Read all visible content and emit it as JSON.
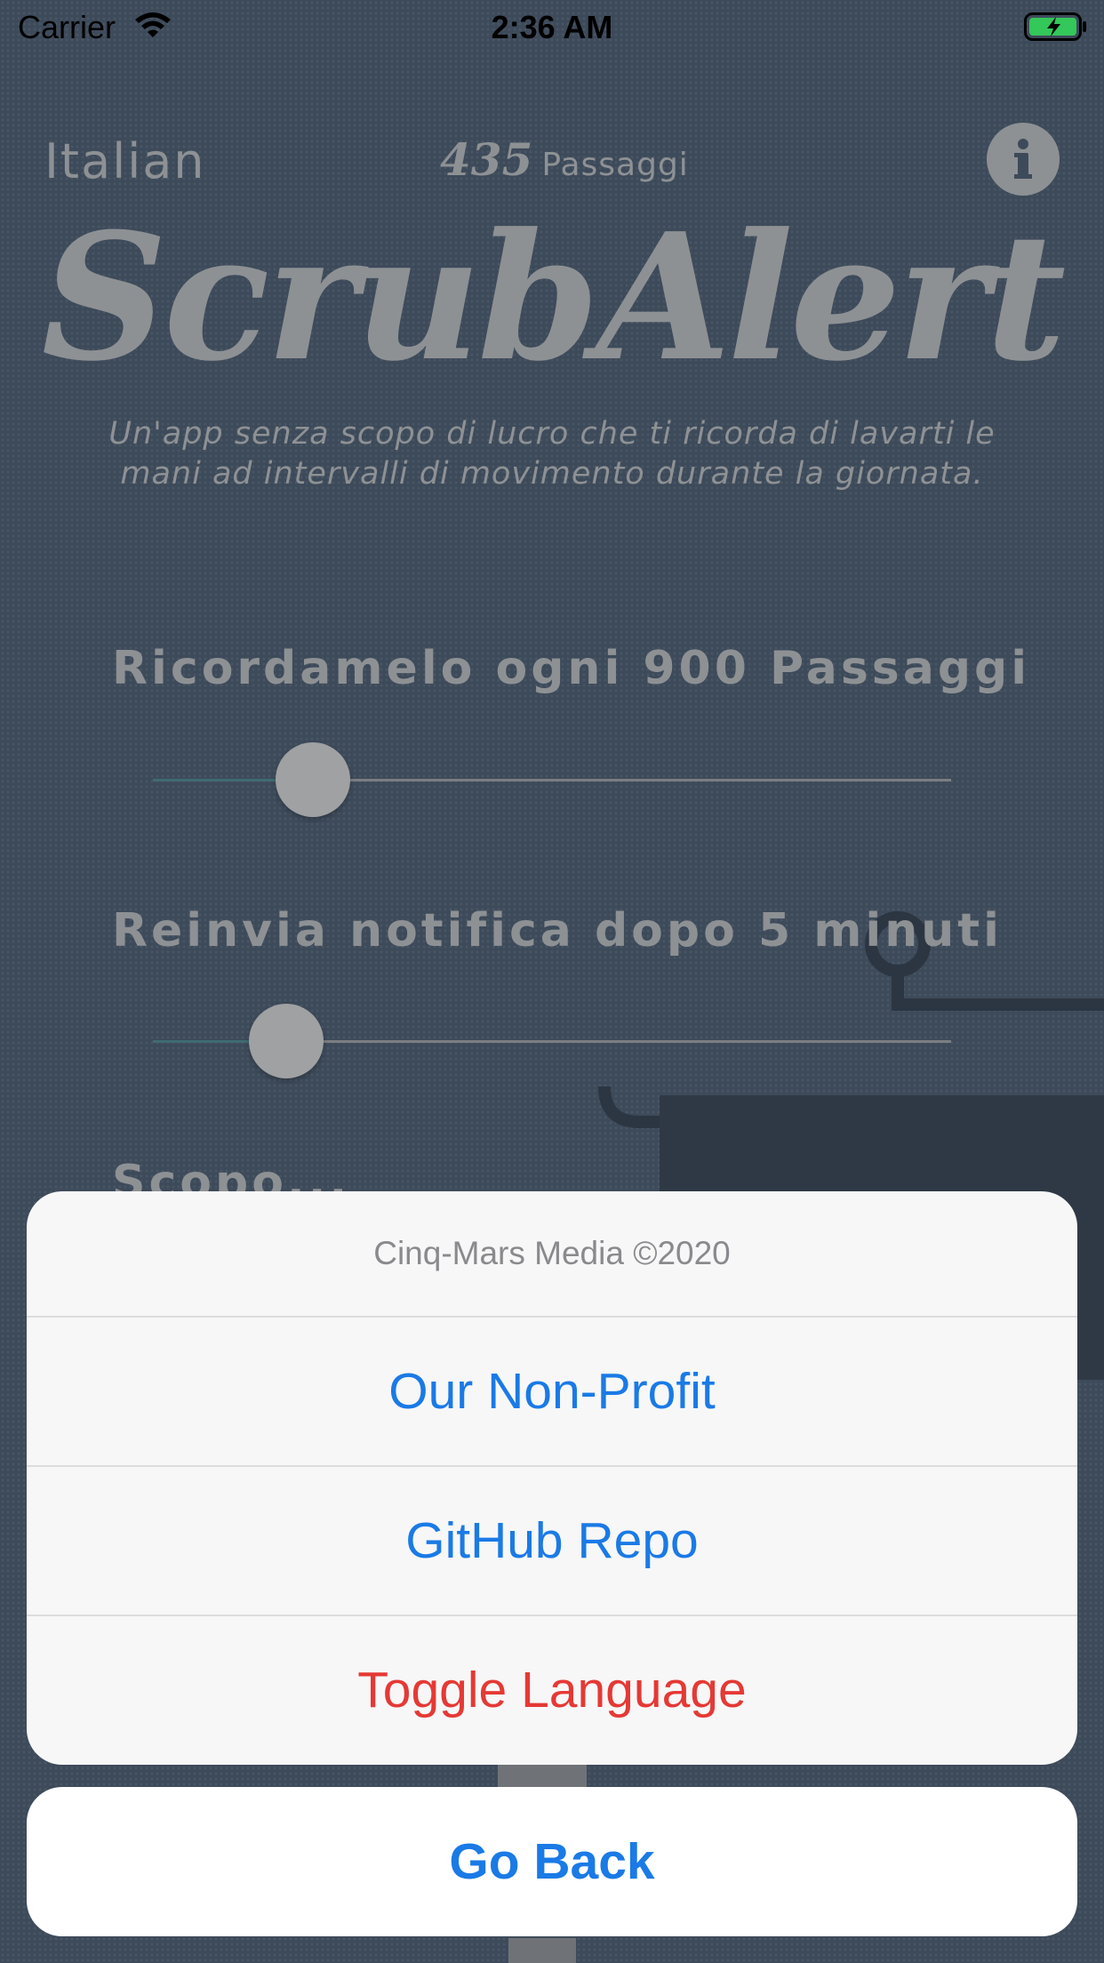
{
  "status_bar": {
    "carrier": "Carrier",
    "time": "2:36 AM",
    "wifi_icon": "wifi-icon",
    "battery_icon": "battery-charging-icon",
    "battery_color": "#34c759"
  },
  "header": {
    "language": "Italian",
    "steps_count": "435",
    "steps_unit": "Passaggi",
    "info_icon": "info-icon"
  },
  "app": {
    "title": "ScrubAlert",
    "subtitle": "Un'app senza scopo di lucro che ti ricorda di lavarti le mani ad intervalli di movimento durante la giornata."
  },
  "settings": {
    "remind_label": "Ricordamelo ogni 900 Passaggi",
    "remind_slider_fraction": 0.2,
    "snooze_label": "Reinvia notifica dopo 5 minuti",
    "snooze_slider_fraction": 0.167,
    "partial_label": "Scopo..."
  },
  "action_sheet": {
    "title": "Cinq-Mars Media ©2020",
    "actions": [
      {
        "label": "Our Non-Profit",
        "style": "default"
      },
      {
        "label": "GitHub Repo",
        "style": "default"
      },
      {
        "label": "Toggle Language",
        "style": "destructive"
      }
    ],
    "cancel_label": "Go Back"
  },
  "colors": {
    "background": "#3d4a5a",
    "text_dim": "#8e9194",
    "action_blue": "#1a7ae6",
    "action_red": "#e53935"
  }
}
